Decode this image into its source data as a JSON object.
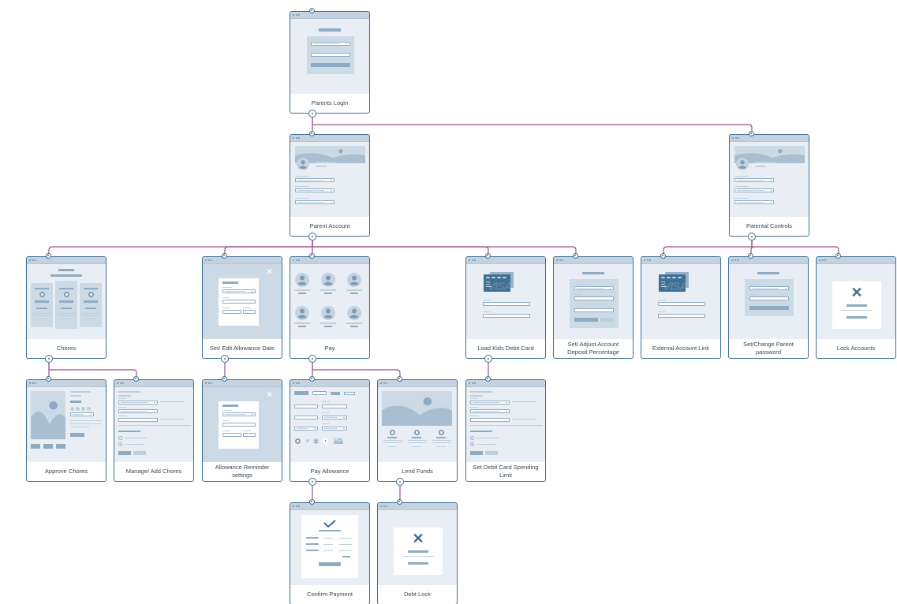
{
  "diagram": {
    "type": "sitemap-wireframe-flow",
    "colors": {
      "card_border": "#3f6f93",
      "connector": "#a04f86",
      "wireframe_fill": "#e8eef3",
      "wireframe_accent": "#8eabc3",
      "card_blue": "#3f6f93"
    },
    "screens": [
      {
        "id": "parents-login",
        "label": "Parents Login",
        "wireframe": "login-form"
      },
      {
        "id": "parent-account",
        "label": "Parent Account",
        "wireframe": "profile-with-dropdowns"
      },
      {
        "id": "parental-controls",
        "label": "Parental Controls",
        "wireframe": "profile-with-dropdowns"
      },
      {
        "id": "chores",
        "label": "Chores",
        "wireframe": "three-column-pricing"
      },
      {
        "id": "set-edit-allowance-date",
        "label": "Set/ Edit Allowance Date",
        "wireframe": "modal-form"
      },
      {
        "id": "pay",
        "label": "Pay",
        "wireframe": "avatar-grid"
      },
      {
        "id": "load-kids-debit-card",
        "label": "Load Kids Debit Card",
        "wireframe": "card-form",
        "card_text": "VISA"
      },
      {
        "id": "set-adjust-deposit",
        "label": "Set/ Adjust Account Deposit Percentage",
        "wireframe": "panel-form"
      },
      {
        "id": "external-account-link",
        "label": "External Account Link",
        "wireframe": "card-form",
        "card_text": "VISA"
      },
      {
        "id": "set-change-parent-password",
        "label": "Set/Change Parent password",
        "wireframe": "password-form"
      },
      {
        "id": "lock-accounts",
        "label": "Lock Accounts",
        "wireframe": "x-dialog"
      },
      {
        "id": "approve-chores",
        "label": "Approve Chores",
        "wireframe": "product-detail"
      },
      {
        "id": "manage-add-chores",
        "label": "Manage/ Add Chores",
        "wireframe": "settings-form"
      },
      {
        "id": "allowance-reminder-settings",
        "label": "Allowance Reminder settings",
        "wireframe": "modal-form"
      },
      {
        "id": "pay-allowance",
        "label": "Pay Allowance",
        "wireframe": "payment-form"
      },
      {
        "id": "lend-funds",
        "label": "Lend Funds",
        "wireframe": "hero-three-features"
      },
      {
        "id": "set-debit-card-spending-limit",
        "label": "Set Debit Card Spending Limit",
        "wireframe": "settings-form"
      },
      {
        "id": "confirm-payment",
        "label": "Confirm Payment",
        "wireframe": "check-receipt"
      },
      {
        "id": "debt-lock",
        "label": "Debt Lock",
        "wireframe": "x-dialog"
      }
    ],
    "links": [
      {
        "from": "parents-login",
        "to": "parent-account"
      },
      {
        "from": "parents-login",
        "to": "parental-controls"
      },
      {
        "from": "parent-account",
        "to": "chores"
      },
      {
        "from": "parent-account",
        "to": "set-edit-allowance-date"
      },
      {
        "from": "parent-account",
        "to": "pay"
      },
      {
        "from": "parent-account",
        "to": "load-kids-debit-card"
      },
      {
        "from": "parent-account",
        "to": "set-adjust-deposit"
      },
      {
        "from": "parental-controls",
        "to": "external-account-link"
      },
      {
        "from": "parental-controls",
        "to": "set-change-parent-password"
      },
      {
        "from": "parental-controls",
        "to": "lock-accounts"
      },
      {
        "from": "chores",
        "to": "approve-chores"
      },
      {
        "from": "chores",
        "to": "manage-add-chores"
      },
      {
        "from": "set-edit-allowance-date",
        "to": "allowance-reminder-settings"
      },
      {
        "from": "pay",
        "to": "pay-allowance"
      },
      {
        "from": "pay",
        "to": "lend-funds"
      },
      {
        "from": "load-kids-debit-card",
        "to": "set-debit-card-spending-limit"
      },
      {
        "from": "pay-allowance",
        "to": "confirm-payment"
      },
      {
        "from": "lend-funds",
        "to": "debt-lock"
      }
    ]
  }
}
